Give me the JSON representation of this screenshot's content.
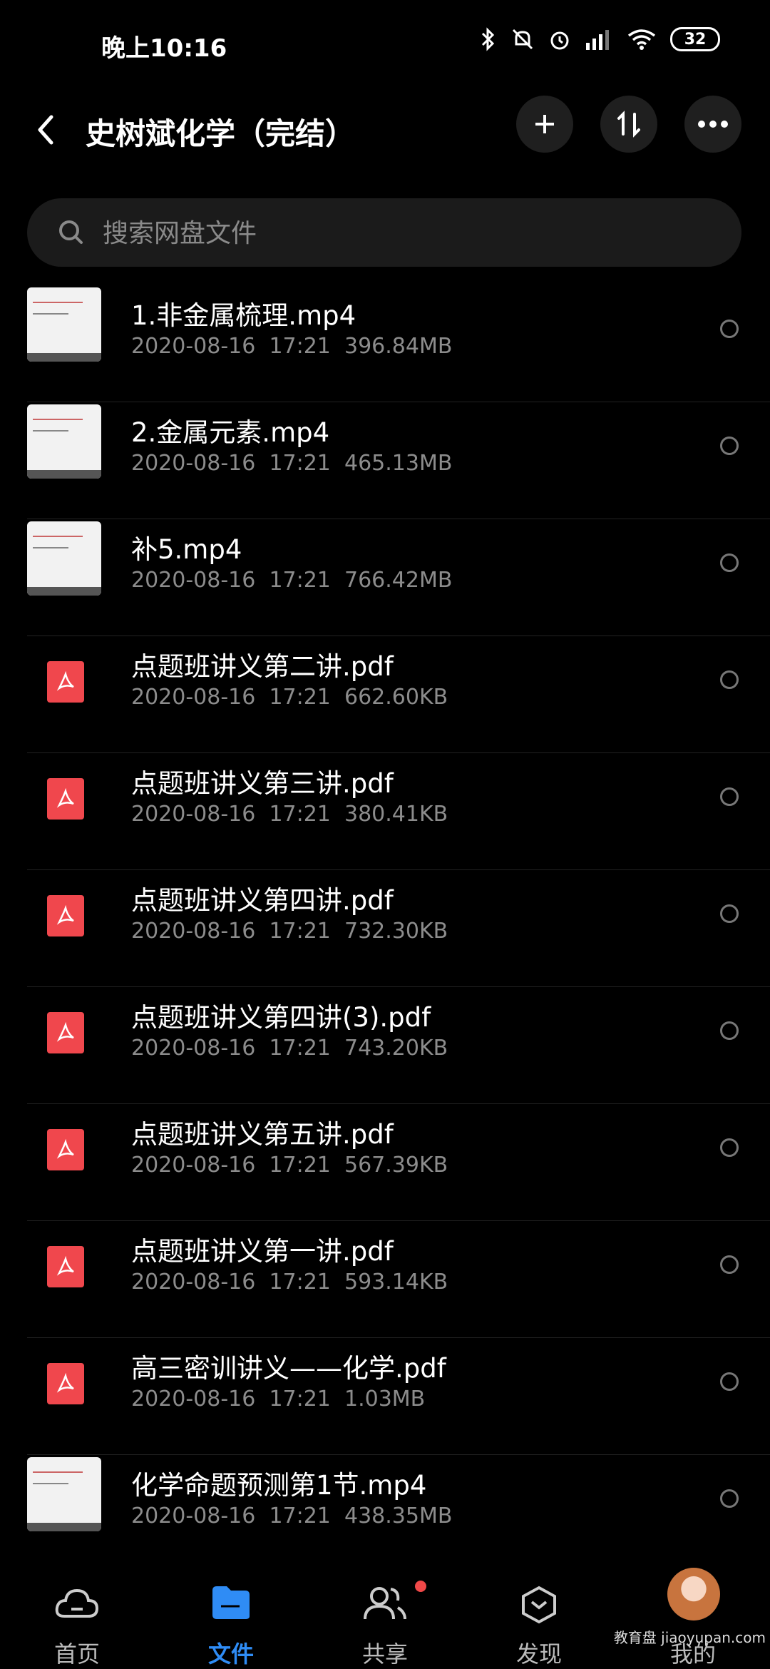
{
  "status": {
    "time": "晚上10:16",
    "battery": "32"
  },
  "header": {
    "title": "史树斌化学（完结）"
  },
  "search": {
    "placeholder": "搜索网盘文件"
  },
  "files": [
    {
      "name": "1.非金属梳理.mp4",
      "date": "2020-08-16",
      "time": "17:21",
      "size": "396.84MB",
      "type": "video"
    },
    {
      "name": "2.金属元素.mp4",
      "date": "2020-08-16",
      "time": "17:21",
      "size": "465.13MB",
      "type": "video"
    },
    {
      "name": "补5.mp4",
      "date": "2020-08-16",
      "time": "17:21",
      "size": "766.42MB",
      "type": "video"
    },
    {
      "name": "点题班讲义第二讲.pdf",
      "date": "2020-08-16",
      "time": "17:21",
      "size": "662.60KB",
      "type": "pdf"
    },
    {
      "name": "点题班讲义第三讲.pdf",
      "date": "2020-08-16",
      "time": "17:21",
      "size": "380.41KB",
      "type": "pdf"
    },
    {
      "name": "点题班讲义第四讲.pdf",
      "date": "2020-08-16",
      "time": "17:21",
      "size": "732.30KB",
      "type": "pdf"
    },
    {
      "name": "点题班讲义第四讲(3).pdf",
      "date": "2020-08-16",
      "time": "17:21",
      "size": "743.20KB",
      "type": "pdf"
    },
    {
      "name": "点题班讲义第五讲.pdf",
      "date": "2020-08-16",
      "time": "17:21",
      "size": "567.39KB",
      "type": "pdf"
    },
    {
      "name": "点题班讲义第一讲.pdf",
      "date": "2020-08-16",
      "time": "17:21",
      "size": "593.14KB",
      "type": "pdf"
    },
    {
      "name": "高三密训讲义——化学.pdf",
      "date": "2020-08-16",
      "time": "17:21",
      "size": "1.03MB",
      "type": "pdf"
    },
    {
      "name": "化学命题预测第1节.mp4",
      "date": "2020-08-16",
      "time": "17:21",
      "size": "438.35MB",
      "type": "video"
    }
  ],
  "nav": [
    {
      "label": "首页",
      "icon": "cloud-icon",
      "active": false
    },
    {
      "label": "文件",
      "icon": "folder-icon",
      "active": true
    },
    {
      "label": "共享",
      "icon": "people-icon",
      "active": false
    },
    {
      "label": "发现",
      "icon": "discover-icon",
      "active": false
    },
    {
      "label": "我的",
      "icon": "avatar",
      "active": false
    }
  ],
  "watermark": "教育盘 jiaoyupan.com",
  "colors": {
    "accent": "#2f8cf5",
    "pdf": "#f0474d",
    "badge": "#f04848"
  }
}
